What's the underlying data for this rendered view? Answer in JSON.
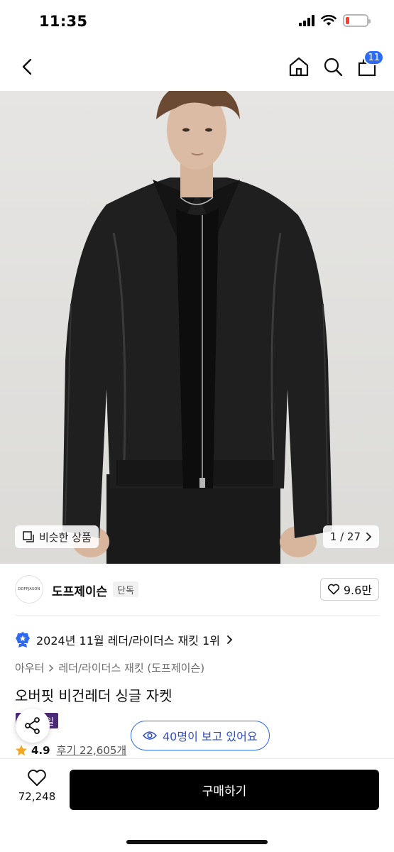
{
  "status_bar": {
    "time": "11:35"
  },
  "nav": {
    "cart_count": "11",
    "icons": [
      "back-icon",
      "home-icon",
      "search-icon",
      "cart-icon"
    ]
  },
  "image": {
    "similar_label": "비슷한 상품",
    "counter": "1 / 27"
  },
  "brand": {
    "logo_text": "DOFFJASON",
    "name": "도프제이슨",
    "tag": "단독",
    "likes": "9.6만"
  },
  "ranking": {
    "text": "2024년 11월 레더/라이더스 재킷 1위"
  },
  "breadcrumb": {
    "category": "아우터",
    "subcategory": "레더/라이더스 재킷 (도프제이슨)"
  },
  "product": {
    "title": "오버핏 비건레더 싱글 자켓",
    "sale_badge": "세일",
    "rating": "4.9",
    "reviews": "후기 22,605개"
  },
  "viewers": {
    "text": "40명이 보고 있어요"
  },
  "bottom": {
    "wish_count": "72,248",
    "buy_label": "구매하기"
  },
  "colors": {
    "accent_blue": "#2f6bf2",
    "sale_purple": "#4b2a76",
    "battery_red": "#ff3b30",
    "star": "#f5a623"
  }
}
